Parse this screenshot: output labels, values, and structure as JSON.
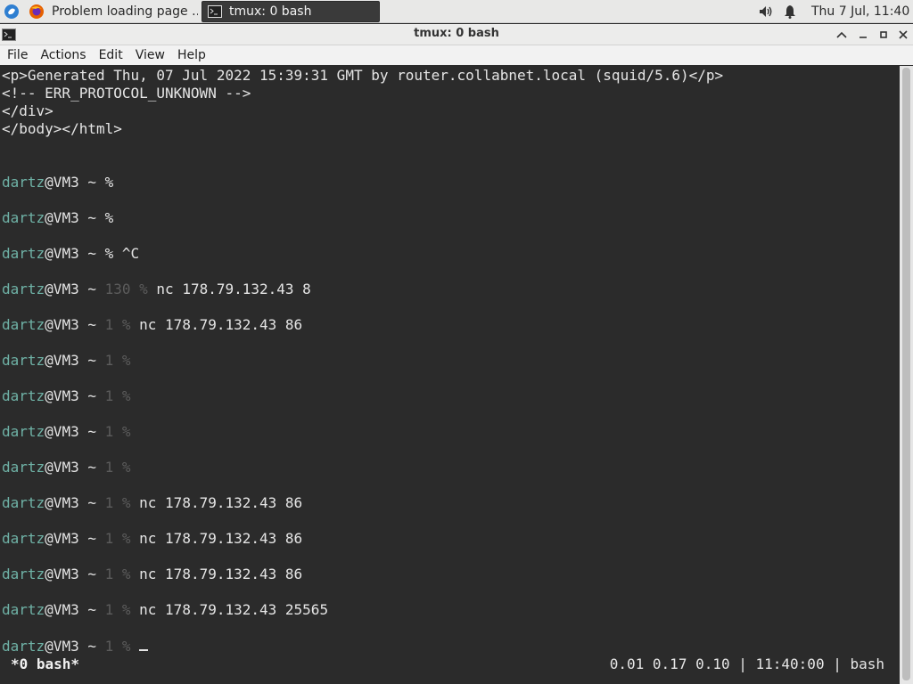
{
  "panel": {
    "tasks": [
      {
        "label": "Problem loading page ..."
      },
      {
        "label": "tmux: 0 bash"
      }
    ],
    "clock": "Thu  7 Jul, 11:40"
  },
  "window": {
    "title": "tmux: 0 bash"
  },
  "menu": [
    "File",
    "Actions",
    "Edit",
    "View",
    "Help"
  ],
  "terminal": {
    "html_lines": [
      "<p>Generated Thu, 07 Jul 2022 15:39:31 GMT by router.collabnet.local (squid/5.6)</p>",
      "<!-- ERR_PROTOCOL_UNKNOWN -->",
      "</div>",
      "</body></html>"
    ],
    "prompt_user": "dartz",
    "prompt_host": "@VM3 ~ ",
    "prompts": [
      {
        "status": "",
        "cmd": "%"
      },
      {
        "status": "",
        "cmd": "%"
      },
      {
        "status": "",
        "cmd": "% ^C"
      },
      {
        "status": "130 %",
        "cmd": " nc 178.79.132.43 8"
      },
      {
        "status": "1 %",
        "cmd": " nc 178.79.132.43 86"
      },
      {
        "status": "1 %",
        "cmd": ""
      },
      {
        "status": "1 %",
        "cmd": ""
      },
      {
        "status": "1 %",
        "cmd": ""
      },
      {
        "status": "1 %",
        "cmd": ""
      },
      {
        "status": "1 %",
        "cmd": " nc 178.79.132.43 86"
      },
      {
        "status": "1 %",
        "cmd": " nc 178.79.132.43 86"
      },
      {
        "status": "1 %",
        "cmd": " nc 178.79.132.43 86"
      },
      {
        "status": "1 %",
        "cmd": " nc 178.79.132.43 25565"
      },
      {
        "status": "1 %",
        "cmd": " "
      }
    ]
  },
  "tmux": {
    "window_label": "*0 bash*",
    "status_right": "0.01 0.17 0.10 | 11:40:00 | bash"
  },
  "colors": {
    "terminal_bg": "#2b2b2b",
    "prompt_user": "#6fb2a6",
    "status_dim": "#5c5c5c"
  }
}
